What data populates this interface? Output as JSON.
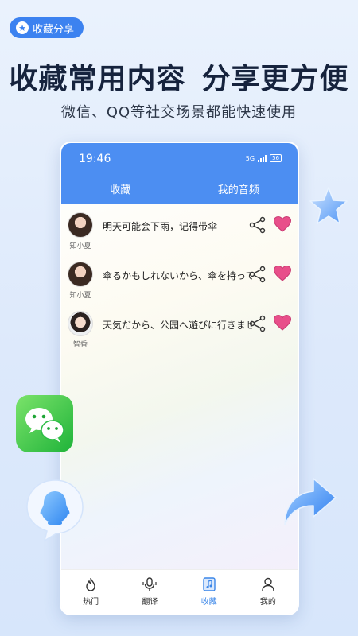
{
  "badge": {
    "label": "收藏分享",
    "icon": "star-icon"
  },
  "headline": {
    "part1": "收藏常用内容",
    "part2": "分享更方便"
  },
  "subline": "微信、QQ等社交场景都能快速使用",
  "phone": {
    "status": {
      "time": "19:46",
      "network": "5G",
      "battery": "56"
    },
    "tabs": [
      {
        "label": "收藏"
      },
      {
        "label": "我的音频"
      }
    ],
    "items": [
      {
        "user": "知小夏",
        "text": "明天可能会下雨，记得带伞"
      },
      {
        "user": "知小夏",
        "text": "傘るかもしれないから、傘を持ってきて"
      },
      {
        "user": "智香",
        "text": "天気だから、公园へ遊びに行きませんか"
      }
    ],
    "nav": [
      {
        "label": "热门",
        "icon": "flame-icon"
      },
      {
        "label": "翻译",
        "icon": "microphone-icon"
      },
      {
        "label": "收藏",
        "icon": "music-note-icon",
        "active": true
      },
      {
        "label": "我的",
        "icon": "person-icon"
      }
    ]
  },
  "colors": {
    "accent": "#4c8ef2",
    "heart": "#e84f8a",
    "headline": "#16233d"
  }
}
